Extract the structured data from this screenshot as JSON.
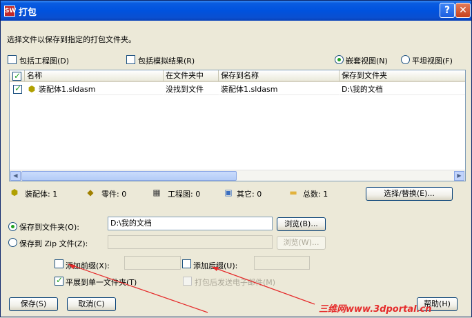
{
  "window": {
    "title": "打包",
    "help_glyph": "?",
    "close_glyph": "✕",
    "app_icon": "SW"
  },
  "instruction": "选择文件以保存到指定的打包文件夹。",
  "options": {
    "include_drawings": {
      "label": "包括工程图(D)",
      "checked": false
    },
    "include_sim_results": {
      "label": "包括模拟结果(R)",
      "checked": false
    },
    "nested_view": {
      "label": "嵌套视图(N)",
      "selected": true
    },
    "flat_view": {
      "label": "平坦视图(F)",
      "selected": false
    }
  },
  "file_list": {
    "columns": [
      "名称",
      "在文件夹中",
      "保存到名称",
      "保存到文件夹"
    ],
    "rows": [
      {
        "checked": true,
        "name": "装配体1.sldasm",
        "in_folder": "没找到文件",
        "save_name": "装配体1.sldasm",
        "save_folder": "D:\\我的文档"
      }
    ],
    "scroll_left": "◀",
    "scroll_right": "▶"
  },
  "summary": {
    "assemblies": "装配体: 1",
    "parts": "零件: 0",
    "drawings": "工程图: 0",
    "others": "其它: 0",
    "total": "总数: 1",
    "select_replace_button": "选择/替换(E)..."
  },
  "save": {
    "to_folder": {
      "label": "保存到文件夹(O):",
      "selected": true,
      "value": "D:\\我的文档",
      "browse": "浏览(B)..."
    },
    "to_zip": {
      "label": "保存到 Zip 文件(Z):",
      "selected": false,
      "value": "",
      "browse": "浏览(W)..."
    },
    "add_prefix": {
      "label": "添加前缀(X):",
      "checked": false
    },
    "add_suffix": {
      "label": "添加后缀(U):",
      "checked": false
    },
    "flatten": {
      "label": "平展到单一文件夹(T)",
      "checked": true
    },
    "email": {
      "label": "打包后发送电子邮件(M)",
      "checked": false,
      "disabled": true
    }
  },
  "buttons": {
    "save": "保存(S)",
    "cancel": "取消(C)",
    "help": "帮助(H)"
  },
  "watermark": "三维网www.3dportal.cn"
}
